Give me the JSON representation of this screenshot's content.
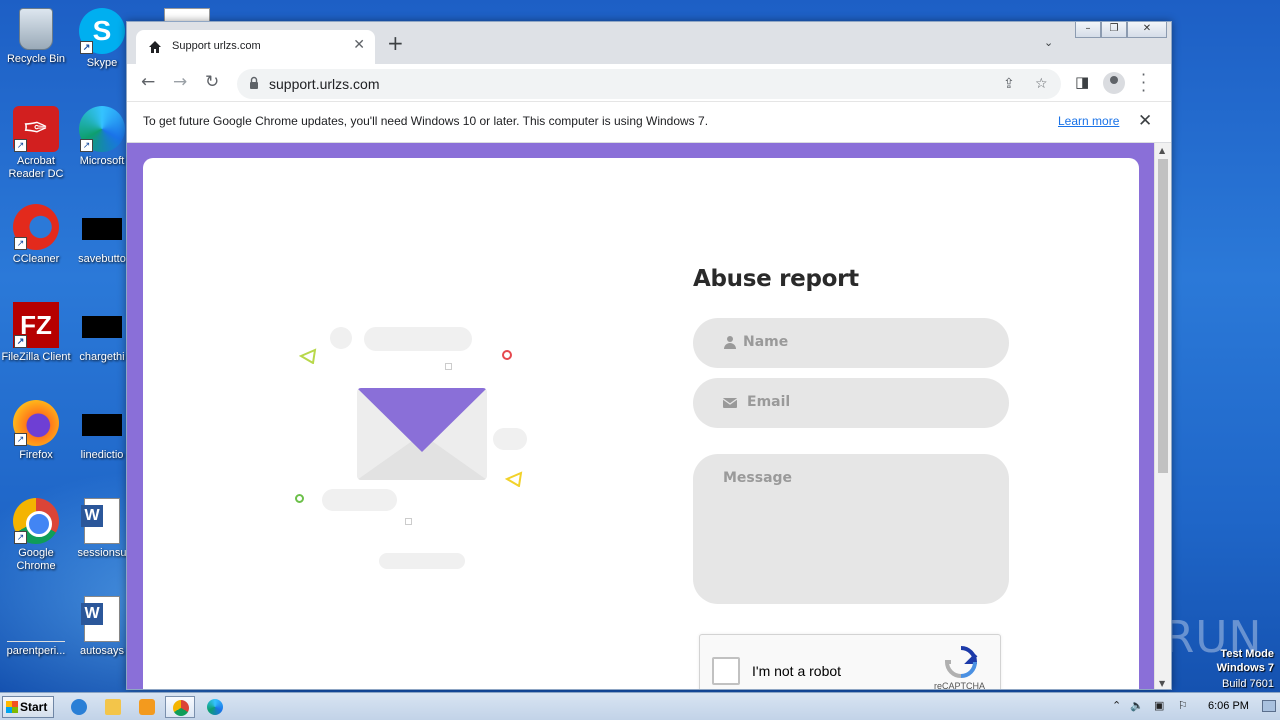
{
  "desktop": {
    "icons": [
      {
        "label": "Recycle Bin"
      },
      {
        "label": "Skype"
      },
      {
        "label": "Acrobat Reader DC"
      },
      {
        "label": "Microsoft"
      },
      {
        "label": "CCleaner"
      },
      {
        "label": "savebutto"
      },
      {
        "label": "FileZilla Client"
      },
      {
        "label": "chargethi"
      },
      {
        "label": "Firefox"
      },
      {
        "label": "linedictio"
      },
      {
        "label": "Google Chrome"
      },
      {
        "label": "sessionsu"
      },
      {
        "label": "parentperi..."
      },
      {
        "label": "autosays"
      }
    ],
    "watermark": "ANY▷RUN",
    "test_mode": {
      "line1": "Test Mode",
      "line2": "Windows 7",
      "line3": "Build 7601"
    }
  },
  "browser": {
    "tab": {
      "title": "Support urlzs.com"
    },
    "address": {
      "url": "support.urlzs.com"
    },
    "infobar": {
      "message": "To get future Google Chrome updates, you'll need Windows 10 or later. This computer is using Windows 7.",
      "link": "Learn more"
    }
  },
  "page": {
    "title": "Abuse report",
    "fields": {
      "name_placeholder": "Name",
      "email_placeholder": "Email",
      "message_placeholder": "Message"
    },
    "recaptcha": {
      "label": "I'm not a robot",
      "brand": "reCAPTCHA"
    },
    "colors": {
      "accent": "#8a6fd8",
      "field_bg": "#e6e6e6"
    }
  },
  "taskbar": {
    "start_label": "Start",
    "clock": "6:06 PM"
  }
}
